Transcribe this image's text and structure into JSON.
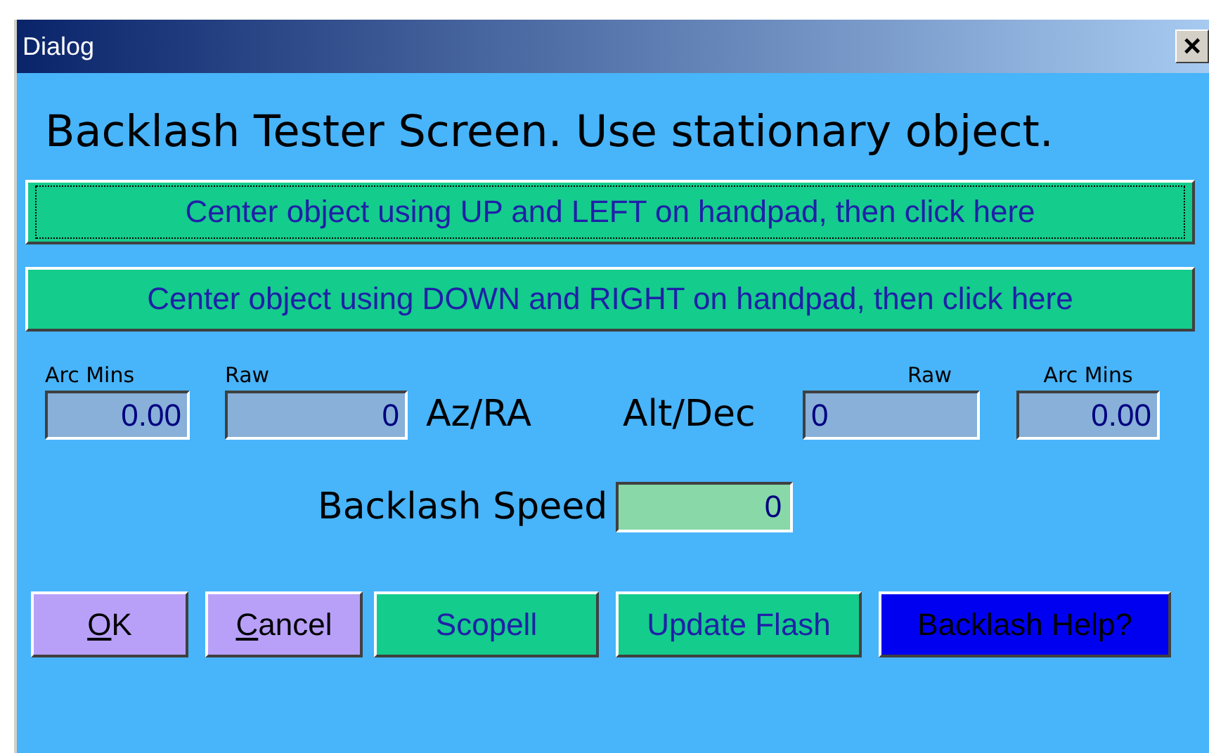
{
  "window": {
    "title": "Dialog",
    "close": "×"
  },
  "heading": "Backlash Tester Screen. Use stationary object.",
  "wide_buttons": [
    {
      "label": "Center object using UP and LEFT on handpad, then click here",
      "focused": true
    },
    {
      "label": "Center object using DOWN and RIGHT on handpad, then click here",
      "focused": false
    }
  ],
  "axes": [
    {
      "label": "Az/RA",
      "fields": [
        {
          "label": "Arc Mins",
          "value": "0.00"
        },
        {
          "label": "Raw",
          "value": "0"
        }
      ]
    },
    {
      "label": "Alt/Dec",
      "fields": [
        {
          "label": "Raw",
          "value": "0"
        },
        {
          "label": "Arc Mins",
          "value": "0.00"
        }
      ]
    }
  ],
  "speed": {
    "label": "Backlash Speed",
    "value": "0"
  },
  "buttons": [
    {
      "label": "OK",
      "kind": "mnemonic"
    },
    {
      "label": "Cancel",
      "kind": "mnemonic"
    },
    {
      "label": "Scopell",
      "kind": "action"
    },
    {
      "label": "Update Flash",
      "kind": "action"
    },
    {
      "label": "Backlash Help?",
      "kind": "help"
    }
  ]
}
